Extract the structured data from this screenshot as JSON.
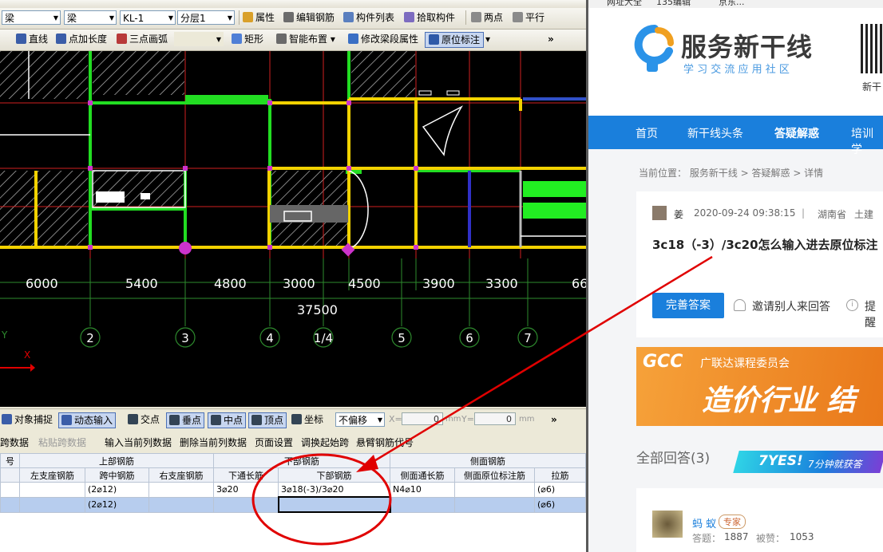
{
  "cad": {
    "toolbar1": {
      "combo_type": "梁",
      "combo_subtype": "梁",
      "combo_name": "KL-1",
      "combo_floor": "分层1",
      "properties": "属性",
      "edit_rebar": "编辑钢筋",
      "component_list": "构件列表",
      "pick_component": "拾取构件",
      "two_points": "两点",
      "parallel": "平行"
    },
    "toolbar2": {
      "line": "直线",
      "point_length": "点加长度",
      "three_point_arc": "三点画弧",
      "rectangle": "矩形",
      "smart_layout": "智能布置",
      "modify_beam_segment": "修改梁段属性",
      "in_situ_mark": "原位标注",
      "more": "»"
    },
    "drawing": {
      "dimensions": [
        "6000",
        "5400",
        "4800",
        "3000",
        "4500",
        "3900",
        "3300",
        "66"
      ],
      "total_dimension": "37500",
      "axis_labels": [
        "2",
        "3",
        "4",
        "1/4",
        "5",
        "6",
        "7"
      ],
      "axis_y": "Y",
      "axis_x": "X"
    },
    "snapbar": {
      "object_snap": "对象捕捉",
      "dynamic_input": "动态输入",
      "intersection": "交点",
      "perpendicular": "垂点",
      "midpoint": "中点",
      "vertex": "顶点",
      "coordinate": "坐标",
      "offset_mode": "不偏移",
      "x_label": "X=",
      "x_value": "0",
      "y_label": "Y=",
      "y_value": "0",
      "unit": "mm",
      "more": "»"
    },
    "actions": {
      "span_data": "跨数据",
      "paste_span": "粘贴跨数据",
      "input_current_column": "输入当前列数据",
      "delete_current_column": "删除当前列数据",
      "page_setup": "页面设置",
      "swap_start_span": "调换起始跨",
      "cantilever_code": "悬臂钢筋代号"
    },
    "grid": {
      "group_headers": [
        "号",
        "上部钢筋",
        "下部钢筋",
        "侧面钢筋"
      ],
      "columns": [
        "左支座钢筋",
        "跨中钢筋",
        "右支座钢筋",
        "下通长筋",
        "下部钢筋",
        "侧面通长筋",
        "侧面原位标注筋",
        "拉筋"
      ],
      "rows": [
        [
          "",
          "(2⌀12)",
          "",
          "3⌀20",
          "3⌀18(-3)/3⌀20",
          "N4⌀10",
          "",
          "(⌀6)"
        ],
        [
          "",
          "(2⌀12)",
          "",
          "",
          "",
          "",
          "",
          "(⌀6)"
        ]
      ]
    }
  },
  "web": {
    "bookmarks": [
      "网址大全",
      "135编辑",
      "京东..."
    ],
    "logo_title": "服务新干线",
    "logo_subtitle": "学 习 交 流 应 用 社 区",
    "qr_caption": "新干",
    "nav": [
      "首页",
      "新干线头条",
      "答疑解惑",
      "培训学"
    ],
    "breadcrumb": "当前位置：  服务新干线 > 答疑解惑 > 详情",
    "question": {
      "user": "姜",
      "datetime": "2020-09-24 09:38:15",
      "separator": "|",
      "region": "湖南省",
      "category": "土建",
      "title": "3c18（-3）/3c20怎么输入进去原位标注",
      "answer_button": "完善答案",
      "invite": "邀请别人来回答",
      "remind": "提醒"
    },
    "banner": {
      "brand": "GCC",
      "org": "广联达课程委员会",
      "slogan": "造价行业 结"
    },
    "answers_header": "全部回答(3)",
    "yes_badge": "7YES!",
    "yes_sub": "7分钟就获答",
    "answer": {
      "user": "蚂 蚁",
      "badge": "专家",
      "answers_label": "答题：",
      "answers_count": "1887",
      "adopted_label": "被赞：",
      "adopted_count": "1053"
    },
    "colors": {
      "nav_blue": "#1a7fdc",
      "button_blue": "#1a7fdc",
      "annotation_red": "#e00000"
    }
  }
}
